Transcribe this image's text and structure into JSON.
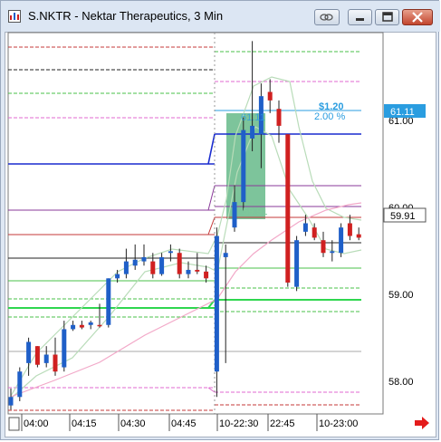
{
  "window": {
    "title": "S.NKTR - Nektar Therapeutics, 3 Min",
    "icon": "chart-app-icon",
    "buttons": [
      "link-icon",
      "minimize-icon",
      "maximize-icon",
      "close-icon"
    ]
  },
  "price_axis": {
    "labels": [
      "61.00",
      "60.00",
      "59.00",
      "58.00"
    ],
    "current_tag": "61.11",
    "last_tag": "59.91"
  },
  "time_axis": {
    "labels": [
      "04:00",
      "04:15",
      "04:30",
      "04:45",
      "10-22:30",
      "22:45",
      "10-23:00"
    ]
  },
  "annotations": {
    "range_price": "$1.20",
    "range_pct": "2.00 %",
    "box_top_label": "61.11",
    "box_bottom_label": "59.91"
  },
  "colors": {
    "up": "#1f5fc8",
    "down": "#d02020",
    "box": "#52b079",
    "accent_blue": "#2a9de0"
  },
  "chart_data": {
    "type": "candlestick",
    "title": "S.NKTR - Nektar Therapeutics, 3 Min",
    "ylim": [
      57.7,
      62.2
    ],
    "candles": [
      {
        "o": 57.8,
        "h": 58.0,
        "l": 57.75,
        "c": 57.9
      },
      {
        "o": 57.9,
        "h": 58.25,
        "l": 57.85,
        "c": 58.2
      },
      {
        "o": 58.3,
        "h": 58.6,
        "l": 58.15,
        "c": 58.55
      },
      {
        "o": 58.5,
        "h": 58.5,
        "l": 58.25,
        "c": 58.28
      },
      {
        "o": 58.3,
        "h": 58.5,
        "l": 58.25,
        "c": 58.4
      },
      {
        "o": 58.4,
        "h": 58.6,
        "l": 58.15,
        "c": 58.2
      },
      {
        "o": 58.25,
        "h": 58.8,
        "l": 58.2,
        "c": 58.7
      },
      {
        "o": 58.7,
        "h": 58.8,
        "l": 58.68,
        "c": 58.75
      },
      {
        "o": 58.75,
        "h": 58.8,
        "l": 58.7,
        "c": 58.72
      },
      {
        "o": 58.75,
        "h": 58.8,
        "l": 58.7,
        "c": 58.78
      },
      {
        "o": 58.75,
        "h": 59.0,
        "l": 58.72,
        "c": 58.74
      },
      {
        "o": 58.75,
        "h": 59.3,
        "l": 58.72,
        "c": 59.3
      },
      {
        "o": 59.3,
        "h": 59.4,
        "l": 59.25,
        "c": 59.35
      },
      {
        "o": 59.35,
        "h": 59.65,
        "l": 59.3,
        "c": 59.5
      },
      {
        "o": 59.45,
        "h": 59.7,
        "l": 59.4,
        "c": 59.52
      },
      {
        "o": 59.5,
        "h": 59.7,
        "l": 59.45,
        "c": 59.55
      },
      {
        "o": 59.5,
        "h": 59.6,
        "l": 59.3,
        "c": 59.35
      },
      {
        "o": 59.35,
        "h": 59.6,
        "l": 59.33,
        "c": 59.55
      },
      {
        "o": 59.6,
        "h": 59.7,
        "l": 59.5,
        "c": 59.62
      },
      {
        "o": 59.6,
        "h": 59.65,
        "l": 59.3,
        "c": 59.35
      },
      {
        "o": 59.35,
        "h": 59.5,
        "l": 59.3,
        "c": 59.4
      },
      {
        "o": 59.4,
        "h": 59.6,
        "l": 59.35,
        "c": 59.38
      },
      {
        "o": 59.38,
        "h": 59.45,
        "l": 59.25,
        "c": 59.3
      },
      {
        "o": 58.2,
        "h": 59.9,
        "l": 57.9,
        "c": 59.8
      },
      {
        "o": 59.55,
        "h": 59.7,
        "l": 58.3,
        "c": 59.6
      },
      {
        "o": 59.9,
        "h": 60.4,
        "l": 59.85,
        "c": 60.2
      },
      {
        "o": 60.2,
        "h": 61.2,
        "l": 60.1,
        "c": 61.05
      },
      {
        "o": 60.95,
        "h": 62.1,
        "l": 60.8,
        "c": 61.1
      },
      {
        "o": 61.0,
        "h": 61.6,
        "l": 60.6,
        "c": 61.45
      },
      {
        "o": 61.5,
        "h": 61.65,
        "l": 61.25,
        "c": 61.4
      },
      {
        "o": 61.3,
        "h": 61.4,
        "l": 60.9,
        "c": 61.1
      },
      {
        "o": 61.0,
        "h": 61.0,
        "l": 59.2,
        "c": 59.25
      },
      {
        "o": 59.2,
        "h": 59.8,
        "l": 59.15,
        "c": 59.75
      },
      {
        "o": 59.85,
        "h": 60.05,
        "l": 59.8,
        "c": 59.95
      },
      {
        "o": 59.9,
        "h": 59.95,
        "l": 59.75,
        "c": 59.78
      },
      {
        "o": 59.75,
        "h": 59.85,
        "l": 59.55,
        "c": 59.6
      },
      {
        "o": 59.6,
        "h": 59.75,
        "l": 59.5,
        "c": 59.62
      },
      {
        "o": 59.6,
        "h": 59.95,
        "l": 59.55,
        "c": 59.9
      },
      {
        "o": 59.95,
        "h": 60.05,
        "l": 59.75,
        "c": 59.8
      },
      {
        "o": 59.82,
        "h": 59.9,
        "l": 59.75,
        "c": 59.78
      }
    ],
    "levels": [
      {
        "price": 61.4,
        "color": "#ffffff"
      },
      {
        "price": 62.05,
        "color": "#cf3b3b"
      }
    ]
  }
}
